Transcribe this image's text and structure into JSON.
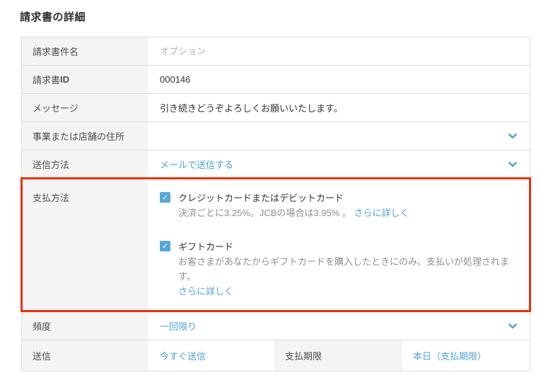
{
  "title": "請求書の詳細",
  "colors": {
    "accent_blue": "#4fa3d8",
    "checkbox_blue": "#55a6d9",
    "highlight_red": "#ee3009",
    "label_bg": "#f4f4f4"
  },
  "form": {
    "subject": {
      "label": "請求書件名",
      "placeholder": "オプション"
    },
    "invoice_id": {
      "label_prefix": "請求書",
      "label_suffix": "ID",
      "value": "000146"
    },
    "message": {
      "label": "メッセージ",
      "value": "引き続きどうぞよろしくお願いいたします。"
    },
    "address": {
      "label": "事業または店舗の住所",
      "value": ""
    },
    "delivery_method": {
      "label": "送信方法",
      "value": "メールで送信する"
    },
    "payment_method": {
      "label": "支払方法",
      "options": [
        {
          "checked": true,
          "checkmark": "✓",
          "title": "クレジットカードまたはデビットカード",
          "description": "決済ごとに3.25%。JCBの場合は3.95% 。",
          "link_label": "さらに詳しく"
        },
        {
          "checked": true,
          "checkmark": "✓",
          "title": "ギフトカード",
          "description": "お客さまがあなたからギフトカードを購入したときにのみ、支払いが処理されます。",
          "link_label": "さらに詳しく"
        }
      ]
    },
    "frequency": {
      "label": "頻度",
      "value": "一回限り"
    },
    "send": {
      "label": "送信",
      "value": "今すぐ送信",
      "due_label": "支払期限",
      "due_value": "本日（支払期限）"
    }
  }
}
